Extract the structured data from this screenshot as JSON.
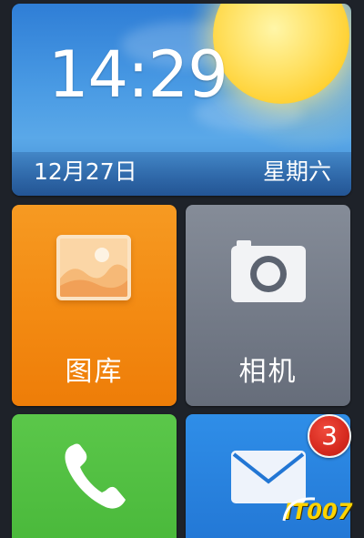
{
  "clock": {
    "time": "14:29",
    "date": "12月27日",
    "weekday": "星期六",
    "weather_icon": "sun-icon"
  },
  "apps": [
    {
      "label": "图库",
      "icon": "gallery-icon",
      "color": "#f38a12"
    },
    {
      "label": "相机",
      "icon": "camera-icon",
      "color": "#727986"
    },
    {
      "label": "",
      "icon": "phone-icon",
      "color": "#49b83a"
    },
    {
      "label": "",
      "icon": "mail-icon",
      "color": "#2276d4"
    }
  ],
  "messages_badge": "3",
  "watermark": "IT007"
}
